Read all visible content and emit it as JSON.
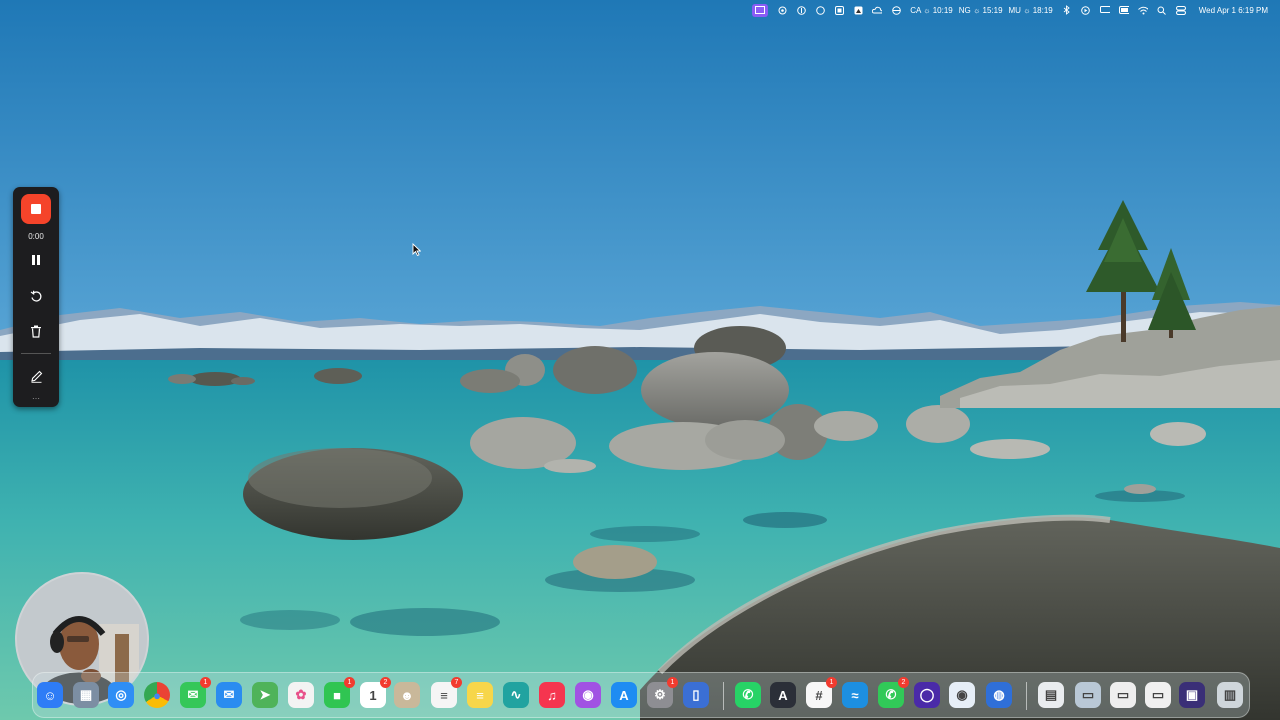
{
  "menubar": {
    "clocks": [
      "CA ☼ 10:19",
      "NG ☼ 15:19",
      "MU ☼ 18:19"
    ],
    "date": "Wed Apr 1  6:19 PM",
    "icons": [
      "screen-record-icon",
      "circle-icon",
      "info-icon",
      "circle-outline-icon",
      "mirror-icon",
      "home-icon",
      "cloud-icon",
      "vpn-icon",
      "bluetooth-icon",
      "play-icon",
      "display-icon",
      "battery-icon",
      "wifi-icon",
      "search-icon",
      "control-center-icon"
    ]
  },
  "recorder": {
    "time": "0:00",
    "stop_icon": "stop-icon",
    "pause_icon": "pause-icon",
    "restart_icon": "restart-icon",
    "delete_icon": "trash-icon",
    "draw_icon": "pencil-icon",
    "stop_color": "#f5442a"
  },
  "dock": {
    "apps": [
      {
        "name": "finder",
        "icon": "finder-icon",
        "color": "#2e7cf6",
        "badge": ""
      },
      {
        "name": "launchpad",
        "icon": "launchpad-icon",
        "color": "#7c8ea3",
        "badge": ""
      },
      {
        "name": "safari",
        "icon": "safari-icon",
        "color": "#2f8ef5",
        "badge": ""
      },
      {
        "name": "chrome",
        "icon": "chrome-icon",
        "color": "#e8e8e8",
        "badge": ""
      },
      {
        "name": "messages",
        "icon": "messages-icon",
        "color": "#35c759",
        "badge": "1"
      },
      {
        "name": "mail",
        "icon": "mail-icon",
        "color": "#2a8cf0",
        "badge": ""
      },
      {
        "name": "maps",
        "icon": "maps-icon",
        "color": "#4fb35a",
        "badge": ""
      },
      {
        "name": "photos",
        "icon": "photos-icon",
        "color": "#f3f3f3",
        "badge": ""
      },
      {
        "name": "facetime",
        "icon": "facetime-icon",
        "color": "#30c552",
        "badge": "1"
      },
      {
        "name": "calendar",
        "icon": "calendar-icon",
        "color": "#ffffff",
        "badge": "2"
      },
      {
        "name": "contacts",
        "icon": "contacts-icon",
        "color": "#c9b89a",
        "badge": ""
      },
      {
        "name": "reminders",
        "icon": "reminders-icon",
        "color": "#f5f5f5",
        "badge": "7"
      },
      {
        "name": "notes",
        "icon": "notes-icon",
        "color": "#f7d64a",
        "badge": ""
      },
      {
        "name": "freeform",
        "icon": "freeform-icon",
        "color": "#21a3a0",
        "badge": ""
      },
      {
        "name": "music",
        "icon": "music-icon",
        "color": "#f5354f",
        "badge": ""
      },
      {
        "name": "podcasts",
        "icon": "podcasts-icon",
        "color": "#a152e3",
        "badge": ""
      },
      {
        "name": "app-store",
        "icon": "app-store-icon",
        "color": "#1e8cf2",
        "badge": ""
      },
      {
        "name": "system-settings",
        "icon": "gear-icon",
        "color": "#8e8e93",
        "badge": "1"
      },
      {
        "name": "simulator",
        "icon": "phone-icon",
        "color": "#3b6fd4",
        "badge": ""
      },
      {
        "name": "whatsapp",
        "icon": "whatsapp-icon",
        "color": "#27d366",
        "badge": ""
      },
      {
        "name": "xcode-instruments",
        "icon": "instruments-icon",
        "color": "#2b2f38",
        "badge": ""
      },
      {
        "name": "slack",
        "icon": "slack-icon",
        "color": "#f7f7f7",
        "badge": "1"
      },
      {
        "name": "docker",
        "icon": "docker-icon",
        "color": "#1d8fe1",
        "badge": ""
      },
      {
        "name": "phone",
        "icon": "phone-call-icon",
        "color": "#31c958",
        "badge": "2"
      },
      {
        "name": "arc",
        "icon": "arc-icon",
        "color": "#4a2aa8",
        "badge": ""
      },
      {
        "name": "proxyman",
        "icon": "proxyman-icon",
        "color": "#e6eef7",
        "badge": ""
      },
      {
        "name": "tower",
        "icon": "tower-icon",
        "color": "#2f6fd8",
        "badge": ""
      },
      {
        "name": "document",
        "icon": "document-icon",
        "color": "#e9ecef",
        "badge": ""
      },
      {
        "name": "screenshot-1",
        "icon": "screenshot-icon",
        "color": "#b9c8d6",
        "badge": ""
      },
      {
        "name": "screenshot-2",
        "icon": "screenshot-icon",
        "color": "#eeeeee",
        "badge": ""
      },
      {
        "name": "screenshot-3",
        "icon": "screenshot-icon",
        "color": "#f0f0f0",
        "badge": ""
      },
      {
        "name": "window-preview",
        "icon": "window-icon",
        "color": "#3a2f77",
        "badge": ""
      },
      {
        "name": "trash",
        "icon": "trash-icon",
        "color": "#cfd6db",
        "badge": ""
      }
    ]
  },
  "cursor_icon": "pointer-icon"
}
